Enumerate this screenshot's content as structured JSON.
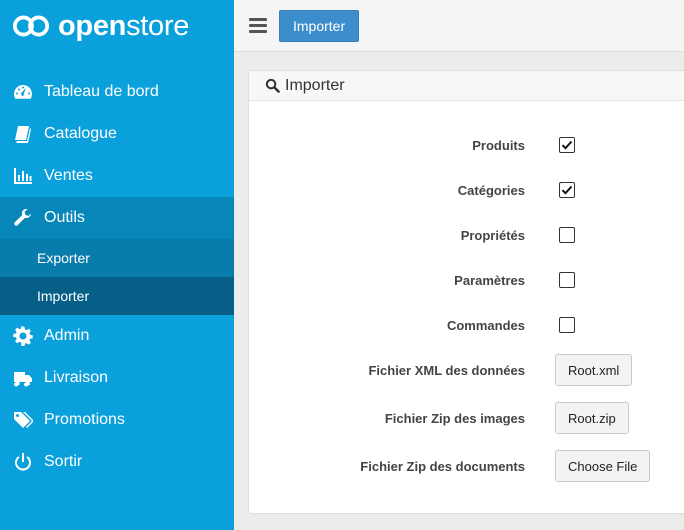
{
  "brand": {
    "name_bold": "open",
    "name_light": "store"
  },
  "sidebar": {
    "items": [
      {
        "label": "Tableau de bord",
        "icon": "dashboard-icon"
      },
      {
        "label": "Catalogue",
        "icon": "book-icon"
      },
      {
        "label": "Ventes",
        "icon": "bar-chart-icon"
      },
      {
        "label": "Outils",
        "icon": "wrench-icon"
      },
      {
        "label": "Admin",
        "icon": "gear-icon"
      },
      {
        "label": "Livraison",
        "icon": "truck-icon"
      },
      {
        "label": "Promotions",
        "icon": "tags-icon"
      },
      {
        "label": "Sortir",
        "icon": "power-icon"
      }
    ],
    "submenu": [
      {
        "label": "Exporter"
      },
      {
        "label": "Importer"
      }
    ],
    "active_item": "Outils",
    "current_subitem": "Importer"
  },
  "topbar": {
    "menu_icon": "hamburger-icon",
    "button_label": "Importer"
  },
  "panel": {
    "title": "Importer",
    "title_icon": "search-icon",
    "checkboxes": [
      {
        "label": "Produits",
        "checked": true
      },
      {
        "label": "Catégories",
        "checked": true
      },
      {
        "label": "Propriétés",
        "checked": false
      },
      {
        "label": "Paramètres",
        "checked": false
      },
      {
        "label": "Commandes",
        "checked": false
      }
    ],
    "files": [
      {
        "label": "Fichier XML des données",
        "button": "Root.xml"
      },
      {
        "label": "Fichier Zip des images",
        "button": "Root.zip"
      },
      {
        "label": "Fichier Zip des documents",
        "button": "Choose File"
      }
    ]
  },
  "colors": {
    "sidebar": "#0aa0dc",
    "sidebar_active": "#0787b9",
    "submenu": "#087cab",
    "submenu_current": "#065f87",
    "primary_button": "#3c8dcb"
  }
}
